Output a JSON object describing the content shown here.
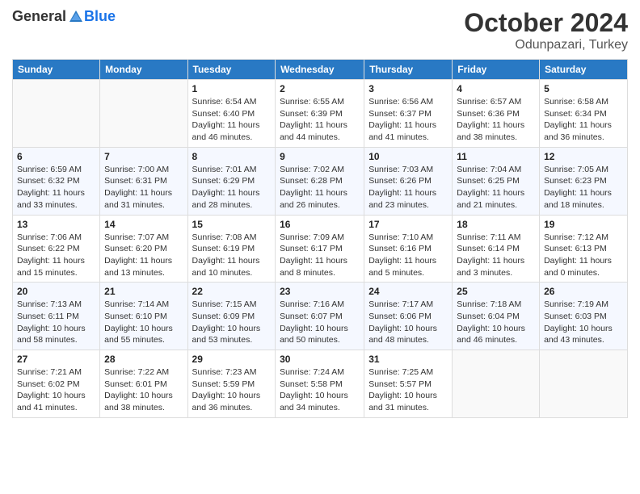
{
  "logo": {
    "general": "General",
    "blue": "Blue"
  },
  "header": {
    "month": "October 2024",
    "location": "Odunpazari, Turkey"
  },
  "weekdays": [
    "Sunday",
    "Monday",
    "Tuesday",
    "Wednesday",
    "Thursday",
    "Friday",
    "Saturday"
  ],
  "weeks": [
    [
      {
        "day": "",
        "info": ""
      },
      {
        "day": "",
        "info": ""
      },
      {
        "day": "1",
        "info": "Sunrise: 6:54 AM\nSunset: 6:40 PM\nDaylight: 11 hours and 46 minutes."
      },
      {
        "day": "2",
        "info": "Sunrise: 6:55 AM\nSunset: 6:39 PM\nDaylight: 11 hours and 44 minutes."
      },
      {
        "day": "3",
        "info": "Sunrise: 6:56 AM\nSunset: 6:37 PM\nDaylight: 11 hours and 41 minutes."
      },
      {
        "day": "4",
        "info": "Sunrise: 6:57 AM\nSunset: 6:36 PM\nDaylight: 11 hours and 38 minutes."
      },
      {
        "day": "5",
        "info": "Sunrise: 6:58 AM\nSunset: 6:34 PM\nDaylight: 11 hours and 36 minutes."
      }
    ],
    [
      {
        "day": "6",
        "info": "Sunrise: 6:59 AM\nSunset: 6:32 PM\nDaylight: 11 hours and 33 minutes."
      },
      {
        "day": "7",
        "info": "Sunrise: 7:00 AM\nSunset: 6:31 PM\nDaylight: 11 hours and 31 minutes."
      },
      {
        "day": "8",
        "info": "Sunrise: 7:01 AM\nSunset: 6:29 PM\nDaylight: 11 hours and 28 minutes."
      },
      {
        "day": "9",
        "info": "Sunrise: 7:02 AM\nSunset: 6:28 PM\nDaylight: 11 hours and 26 minutes."
      },
      {
        "day": "10",
        "info": "Sunrise: 7:03 AM\nSunset: 6:26 PM\nDaylight: 11 hours and 23 minutes."
      },
      {
        "day": "11",
        "info": "Sunrise: 7:04 AM\nSunset: 6:25 PM\nDaylight: 11 hours and 21 minutes."
      },
      {
        "day": "12",
        "info": "Sunrise: 7:05 AM\nSunset: 6:23 PM\nDaylight: 11 hours and 18 minutes."
      }
    ],
    [
      {
        "day": "13",
        "info": "Sunrise: 7:06 AM\nSunset: 6:22 PM\nDaylight: 11 hours and 15 minutes."
      },
      {
        "day": "14",
        "info": "Sunrise: 7:07 AM\nSunset: 6:20 PM\nDaylight: 11 hours and 13 minutes."
      },
      {
        "day": "15",
        "info": "Sunrise: 7:08 AM\nSunset: 6:19 PM\nDaylight: 11 hours and 10 minutes."
      },
      {
        "day": "16",
        "info": "Sunrise: 7:09 AM\nSunset: 6:17 PM\nDaylight: 11 hours and 8 minutes."
      },
      {
        "day": "17",
        "info": "Sunrise: 7:10 AM\nSunset: 6:16 PM\nDaylight: 11 hours and 5 minutes."
      },
      {
        "day": "18",
        "info": "Sunrise: 7:11 AM\nSunset: 6:14 PM\nDaylight: 11 hours and 3 minutes."
      },
      {
        "day": "19",
        "info": "Sunrise: 7:12 AM\nSunset: 6:13 PM\nDaylight: 11 hours and 0 minutes."
      }
    ],
    [
      {
        "day": "20",
        "info": "Sunrise: 7:13 AM\nSunset: 6:11 PM\nDaylight: 10 hours and 58 minutes."
      },
      {
        "day": "21",
        "info": "Sunrise: 7:14 AM\nSunset: 6:10 PM\nDaylight: 10 hours and 55 minutes."
      },
      {
        "day": "22",
        "info": "Sunrise: 7:15 AM\nSunset: 6:09 PM\nDaylight: 10 hours and 53 minutes."
      },
      {
        "day": "23",
        "info": "Sunrise: 7:16 AM\nSunset: 6:07 PM\nDaylight: 10 hours and 50 minutes."
      },
      {
        "day": "24",
        "info": "Sunrise: 7:17 AM\nSunset: 6:06 PM\nDaylight: 10 hours and 48 minutes."
      },
      {
        "day": "25",
        "info": "Sunrise: 7:18 AM\nSunset: 6:04 PM\nDaylight: 10 hours and 46 minutes."
      },
      {
        "day": "26",
        "info": "Sunrise: 7:19 AM\nSunset: 6:03 PM\nDaylight: 10 hours and 43 minutes."
      }
    ],
    [
      {
        "day": "27",
        "info": "Sunrise: 7:21 AM\nSunset: 6:02 PM\nDaylight: 10 hours and 41 minutes."
      },
      {
        "day": "28",
        "info": "Sunrise: 7:22 AM\nSunset: 6:01 PM\nDaylight: 10 hours and 38 minutes."
      },
      {
        "day": "29",
        "info": "Sunrise: 7:23 AM\nSunset: 5:59 PM\nDaylight: 10 hours and 36 minutes."
      },
      {
        "day": "30",
        "info": "Sunrise: 7:24 AM\nSunset: 5:58 PM\nDaylight: 10 hours and 34 minutes."
      },
      {
        "day": "31",
        "info": "Sunrise: 7:25 AM\nSunset: 5:57 PM\nDaylight: 10 hours and 31 minutes."
      },
      {
        "day": "",
        "info": ""
      },
      {
        "day": "",
        "info": ""
      }
    ]
  ]
}
